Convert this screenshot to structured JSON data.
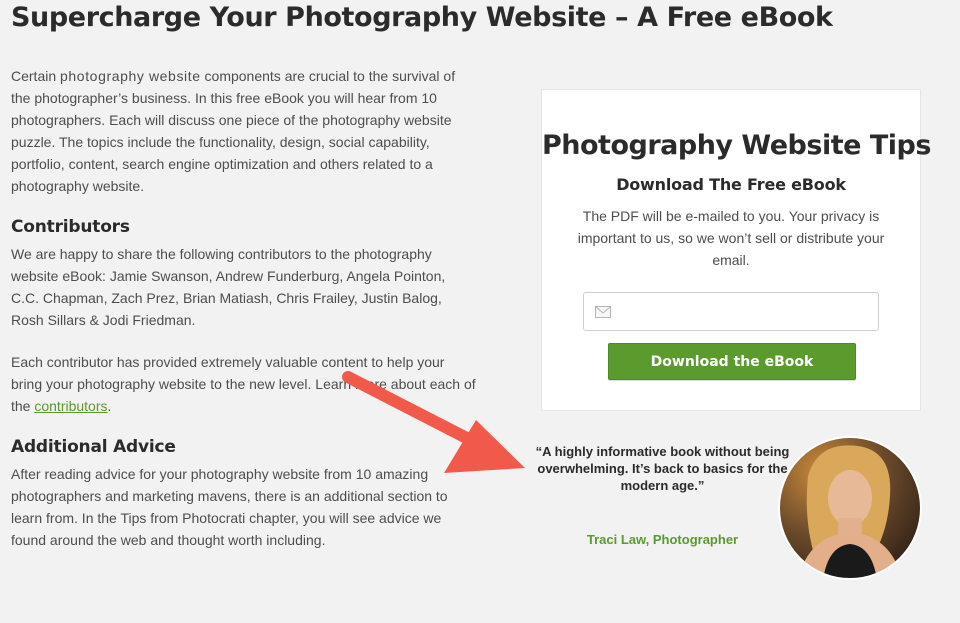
{
  "header": {
    "title": "Supercharge Your Photography Website – A Free eBook"
  },
  "intro": {
    "pre": "Certain ",
    "highlight": "photography website",
    "post": " components are crucial to the survival of the photographer’s business. In this free eBook you will hear from 10 photographers. Each will discuss one piece of the photography website puzzle. The topics include the functionality, design, social capability, portfolio, content, search engine optimization and others related to a photography website."
  },
  "contributors": {
    "heading": "Contributors",
    "text": "We are happy to share the following contributors to the photography website eBook: Jamie Swanson, Andrew Funderburg, Angela Pointon, C.C. Chapman, Zach Prez, Brian Matiash, Chris Frailey, Justin Balog, Rosh Sillars & Jodi Friedman.",
    "more_pre": "Each contributor has provided extremely valuable content to help your bring your photography website to the new level. Learn more about each of the ",
    "more_link": "contributors",
    "more_post": "."
  },
  "advice": {
    "heading": "Additional Advice",
    "text": "After reading advice for your photography website from 10 amazing photographers and marketing mavens, there is an additional section to learn from. In the Tips from Photocrati chapter, you will see advice we found around the web and thought worth including."
  },
  "form": {
    "title": "Photography Website Tips",
    "subtitle": "Download The Free eBook",
    "description": "The PDF will be e-mailed to you. Your privacy is important to us, so we won’t sell or distribute your email.",
    "email_value": "",
    "email_placeholder": "",
    "button_label": "Download the eBook"
  },
  "testimonial": {
    "quote": "“A highly informative book without being overwhelming. It’s back to basics for the modern age.”",
    "author": "Traci Law, Photographer"
  },
  "colors": {
    "accent_green": "#5b9b2d",
    "arrow_red": "#f15a4a",
    "link_green": "#5a9a2c"
  },
  "icons": {
    "email": "envelope-icon",
    "arrow": "arrow-annotation"
  }
}
